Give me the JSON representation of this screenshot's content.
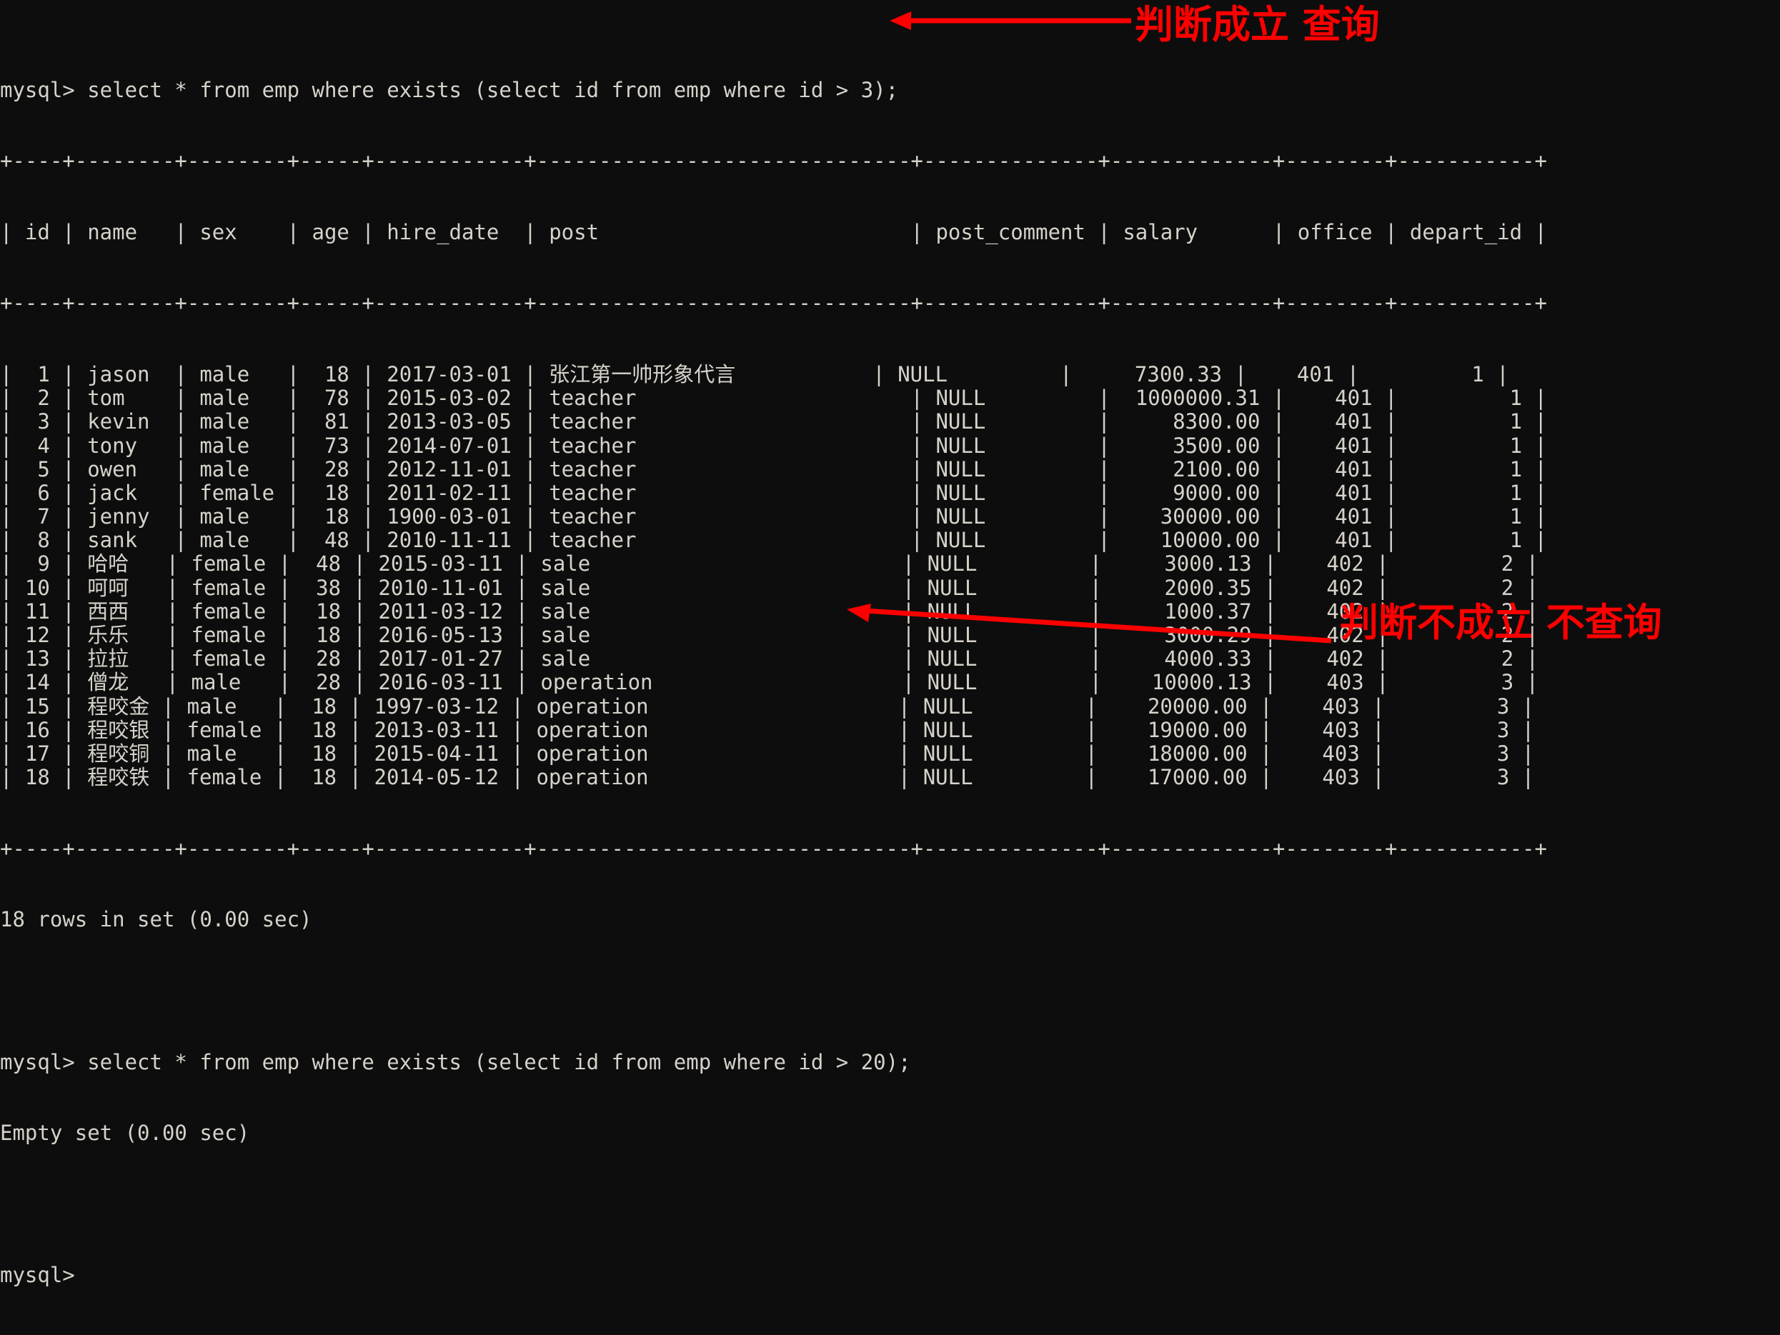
{
  "terminal": {
    "prompt": "mysql>",
    "background_color": "#0d0d0d",
    "foreground_color": "#d6d2ca",
    "annotation_color": "#fe0000",
    "command_1": "mysql> select * from emp where exists (select id from emp where id > 3);",
    "command_2": "mysql> select * from emp where exists (select id from emp where id > 20);",
    "result_1_status": "18 rows in set (0.00 sec)",
    "result_2_status": "Empty set (0.00 sec)",
    "final_prompt": "mysql>",
    "table_border_top": "+----+--------+--------+-----+------------+------------------------------+--------------+------------+--------+-----------+",
    "table_border_mid": "+----+--------+--------+-----+------------+------------------------------+--------------+------------+--------+-----------+",
    "table_border_bottom": "+----+--------+--------+-----+------------+------------------------------+--------------+------------+--------+-----------+"
  },
  "result_table": {
    "columns": [
      "id",
      "name",
      "sex",
      "age",
      "hire_date",
      "post",
      "post_comment",
      "salary",
      "office",
      "depart_id"
    ],
    "row_count_label": "18 rows in set (0.00 sec)",
    "rows": [
      {
        "id": "1",
        "name": "jason",
        "sex": "male",
        "age": "18",
        "hire_date": "2017-03-01",
        "post": "张江第一帅形象代言",
        "post_comment": "NULL",
        "salary": "7300.33",
        "office": "401",
        "depart_id": "1"
      },
      {
        "id": "2",
        "name": "tom",
        "sex": "male",
        "age": "78",
        "hire_date": "2015-03-02",
        "post": "teacher",
        "post_comment": "NULL",
        "salary": "1000000.31",
        "office": "401",
        "depart_id": "1"
      },
      {
        "id": "3",
        "name": "kevin",
        "sex": "male",
        "age": "81",
        "hire_date": "2013-03-05",
        "post": "teacher",
        "post_comment": "NULL",
        "salary": "8300.00",
        "office": "401",
        "depart_id": "1"
      },
      {
        "id": "4",
        "name": "tony",
        "sex": "male",
        "age": "73",
        "hire_date": "2014-07-01",
        "post": "teacher",
        "post_comment": "NULL",
        "salary": "3500.00",
        "office": "401",
        "depart_id": "1"
      },
      {
        "id": "5",
        "name": "owen",
        "sex": "male",
        "age": "28",
        "hire_date": "2012-11-01",
        "post": "teacher",
        "post_comment": "NULL",
        "salary": "2100.00",
        "office": "401",
        "depart_id": "1"
      },
      {
        "id": "6",
        "name": "jack",
        "sex": "female",
        "age": "18",
        "hire_date": "2011-02-11",
        "post": "teacher",
        "post_comment": "NULL",
        "salary": "9000.00",
        "office": "401",
        "depart_id": "1"
      },
      {
        "id": "7",
        "name": "jenny",
        "sex": "male",
        "age": "18",
        "hire_date": "1900-03-01",
        "post": "teacher",
        "post_comment": "NULL",
        "salary": "30000.00",
        "office": "401",
        "depart_id": "1"
      },
      {
        "id": "8",
        "name": "sank",
        "sex": "male",
        "age": "48",
        "hire_date": "2010-11-11",
        "post": "teacher",
        "post_comment": "NULL",
        "salary": "10000.00",
        "office": "401",
        "depart_id": "1"
      },
      {
        "id": "9",
        "name": "哈哈",
        "sex": "female",
        "age": "48",
        "hire_date": "2015-03-11",
        "post": "sale",
        "post_comment": "NULL",
        "salary": "3000.13",
        "office": "402",
        "depart_id": "2"
      },
      {
        "id": "10",
        "name": "呵呵",
        "sex": "female",
        "age": "38",
        "hire_date": "2010-11-01",
        "post": "sale",
        "post_comment": "NULL",
        "salary": "2000.35",
        "office": "402",
        "depart_id": "2"
      },
      {
        "id": "11",
        "name": "西西",
        "sex": "female",
        "age": "18",
        "hire_date": "2011-03-12",
        "post": "sale",
        "post_comment": "NULL",
        "salary": "1000.37",
        "office": "402",
        "depart_id": "2"
      },
      {
        "id": "12",
        "name": "乐乐",
        "sex": "female",
        "age": "18",
        "hire_date": "2016-05-13",
        "post": "sale",
        "post_comment": "NULL",
        "salary": "3000.29",
        "office": "402",
        "depart_id": "2"
      },
      {
        "id": "13",
        "name": "拉拉",
        "sex": "female",
        "age": "28",
        "hire_date": "2017-01-27",
        "post": "sale",
        "post_comment": "NULL",
        "salary": "4000.33",
        "office": "402",
        "depart_id": "2"
      },
      {
        "id": "14",
        "name": "僧龙",
        "sex": "male",
        "age": "28",
        "hire_date": "2016-03-11",
        "post": "operation",
        "post_comment": "NULL",
        "salary": "10000.13",
        "office": "403",
        "depart_id": "3"
      },
      {
        "id": "15",
        "name": "程咬金",
        "sex": "male",
        "age": "18",
        "hire_date": "1997-03-12",
        "post": "operation",
        "post_comment": "NULL",
        "salary": "20000.00",
        "office": "403",
        "depart_id": "3"
      },
      {
        "id": "16",
        "name": "程咬银",
        "sex": "female",
        "age": "18",
        "hire_date": "2013-03-11",
        "post": "operation",
        "post_comment": "NULL",
        "salary": "19000.00",
        "office": "403",
        "depart_id": "3"
      },
      {
        "id": "17",
        "name": "程咬铜",
        "sex": "male",
        "age": "18",
        "hire_date": "2015-04-11",
        "post": "operation",
        "post_comment": "NULL",
        "salary": "18000.00",
        "office": "403",
        "depart_id": "3"
      },
      {
        "id": "18",
        "name": "程咬铁",
        "sex": "female",
        "age": "18",
        "hire_date": "2014-05-12",
        "post": "operation",
        "post_comment": "NULL",
        "salary": "17000.00",
        "office": "403",
        "depart_id": "3"
      }
    ]
  },
  "annotations": [
    {
      "text": "判断成立 查询",
      "color": "#fe0000"
    },
    {
      "text": "判断不成立 不查询",
      "color": "#fe0000"
    }
  ]
}
